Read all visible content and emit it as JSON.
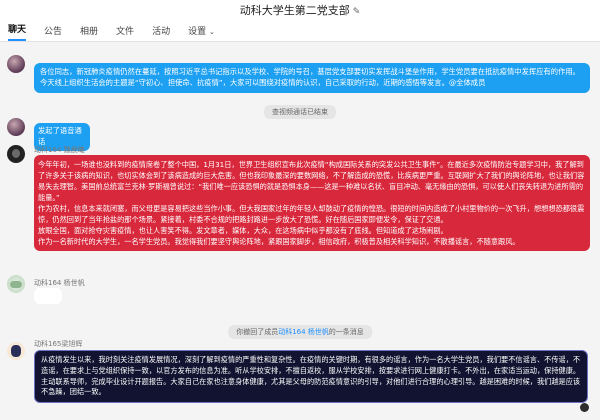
{
  "window": {
    "title": "动科大学生第二党支部"
  },
  "tabs": [
    {
      "label": "聊天",
      "active": true
    },
    {
      "label": "公告"
    },
    {
      "label": "相册"
    },
    {
      "label": "文件"
    },
    {
      "label": "活动"
    },
    {
      "label": "设置"
    }
  ],
  "chat": {
    "msg1": {
      "text": "各位同志，新冠肺炎疫情仍然在蔓延，按照习近平总书记指示以及学校、学院的号召，基层党支部要切实发挥战斗堡垒作用，学生党员要在抵抗疫情中发挥应有的作用。今天线上组织生活会的主题是“守初心、担使命、抗疫情”，大家可以围绕对疫情的认识，自己采取的行动，近期的感悟等发言。@全体成员"
    },
    "sys1": "查视频通话已结束",
    "msg2": {
      "text": "发起了语音通话"
    },
    "msg3": {
      "sender": "动科164 魏晨曦",
      "text": "今年年初，一场谁也没料到的疫情席卷了整个中国，1月31日，世界卫生组织宣布此次疫情“构成国际关系的突发公共卫生事件”。在最近多次疫情防治专题学习中，我了解到了许多关于该病的知识，也切实体会到了该病造成的巨大危害。但也我印象最深的要数网络，不了解造成的恐慌，比疾病更严重。互联网扩大了我们的舆论阵地，也让我们容易失去理智。美国前总统富兰克林·罗斯福曾说过：“我们唯一应该恐惧的就是恐惧本身——这是一种难以名状、盲目冲动、毫无缘由的恐惧，可以使人们丧失转退为进所需的能量。”\n作为农村，信息本来就闭塞，而父母更是容易把这些当作小事。但大我国家过年的年轻人却鼓动了疫情的惶恐。很短的时间内造成了小村里物价的一次飞升，想想想恐都很震惊，仍然回到了当年抢盐的那个场景。紧接着，村委不合规的把路封路进一步放大了恐慌。好在随后国家即便发令，保证了交通。\n放眼全国，面对抢夺灾害疫情，也让人害笑不得。发文章者，媒体，大众，在这场病中似乎都没有了底线。但知道成了这场闹剧。\n作为一名新时代的大学生，一名学生党员。我觉得我们要坚守舆论阵地，紧跟国家脚步，相信政府，积极普及相关科学知识，不散播谣言，不随意跟风。"
    },
    "msg4": {
      "sender": "动科164 杨世帆"
    },
    "sys2": {
      "prefix": "你撤回了成员",
      "highlight": "动科164 杨世帆",
      "suffix": "的一条消息"
    },
    "msg5": {
      "sender": "动科165梁旭辉",
      "text": "从疫情发生以来，我时刻关注疫情发展情况，深刻了解到疫情的严重性和复杂性。在疫情的关键时期，有很多的谣言，作为一名大学生党员，我们要不信谣言、不传谣，不造谣，在要求上与党组织保持一致，以官方发布的信息为准。听从学校安排，不擅自返校，服从学校安排，按要求进行网上健康打卡。不外出，在家适当运动，保持健康。主动联系导师，完成毕业设计开题报告。大家自己在家也注意身体健康，尤其是父母的防范疫情意识的引导，对他们进行合理的心理引导。越是困难的时候，我们越是应该不急躁，团结一致。"
    }
  }
}
